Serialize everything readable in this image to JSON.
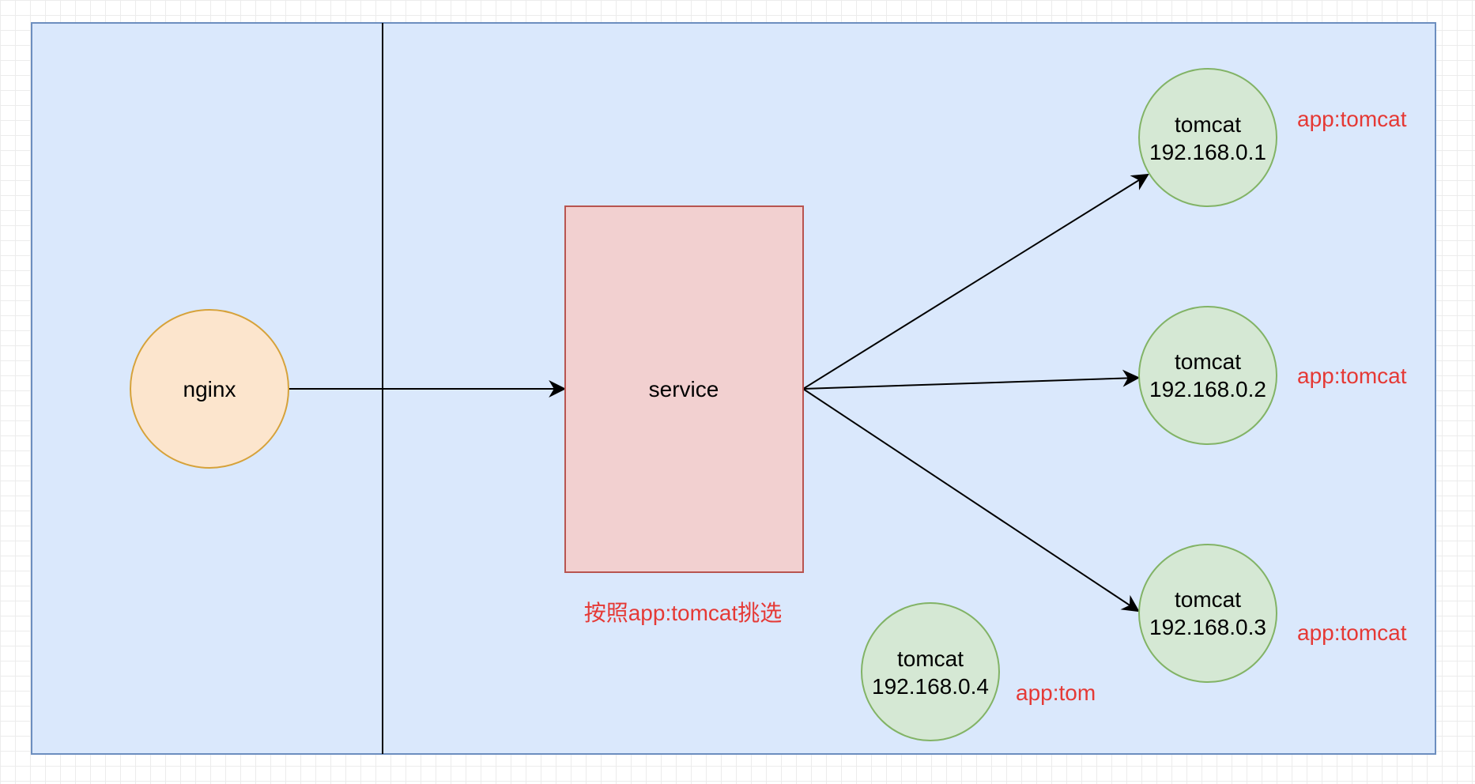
{
  "colors": {
    "container_fill": "#dae8fc",
    "container_stroke": "#6c8ebf",
    "nginx_fill": "#fce5cd",
    "nginx_stroke": "#d6a23a",
    "service_fill": "#f2d0d0",
    "service_stroke": "#b85450",
    "pod_fill": "#d5e8d4",
    "pod_stroke": "#82b366",
    "label_red": "#e53935",
    "edge": "#000000"
  },
  "nginx": {
    "label": "nginx"
  },
  "service": {
    "label": "service",
    "selector_note": "按照app:tomcat挑选"
  },
  "pods": [
    {
      "name": "tomcat",
      "ip": "192.168.0.1",
      "tag": "app:tomcat"
    },
    {
      "name": "tomcat",
      "ip": "192.168.0.2",
      "tag": "app:tomcat"
    },
    {
      "name": "tomcat",
      "ip": "192.168.0.3",
      "tag": "app:tomcat"
    },
    {
      "name": "tomcat",
      "ip": "192.168.0.4",
      "tag": "app:tom"
    }
  ]
}
